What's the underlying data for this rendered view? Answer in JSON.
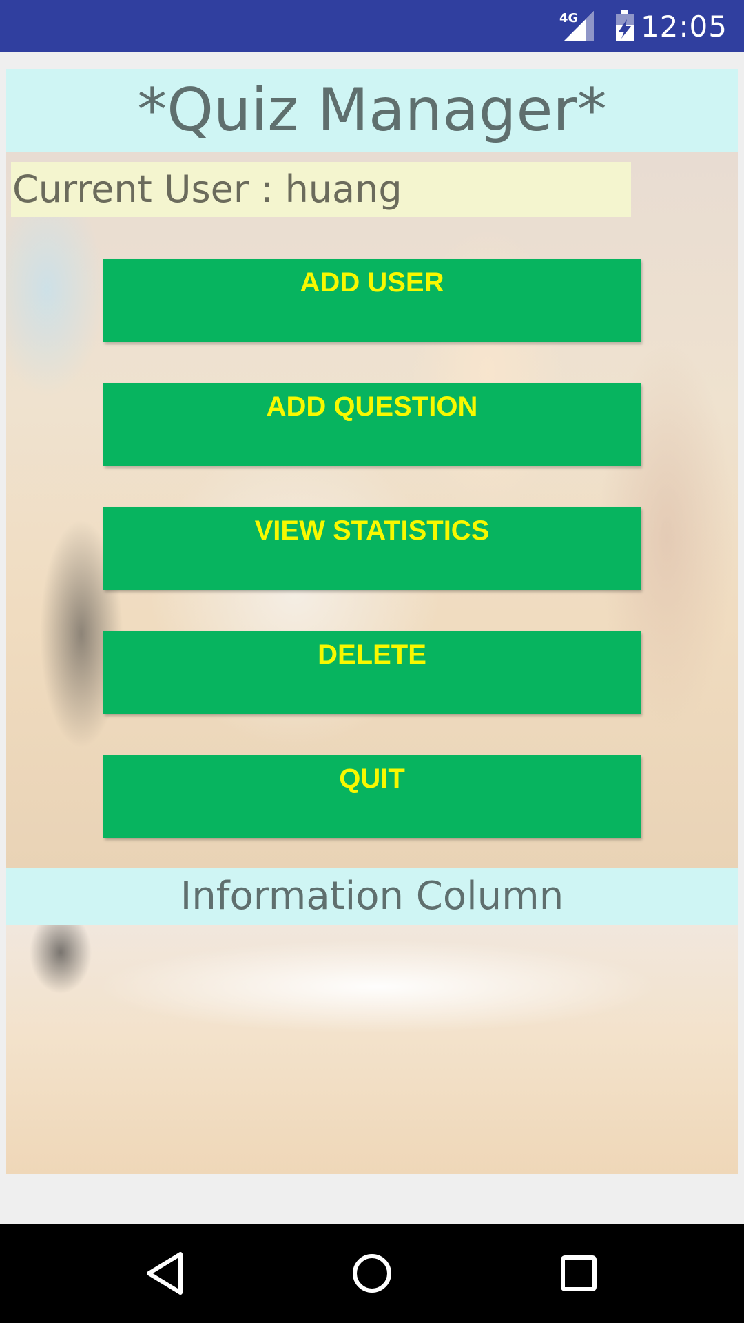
{
  "status_bar": {
    "time": "12:05",
    "network_label": "4G",
    "icons": [
      "signal-icon",
      "battery-icon"
    ]
  },
  "app": {
    "title": "*Quiz Manager*",
    "current_user": "Current User : huang",
    "buttons": [
      {
        "label": "ADD USER"
      },
      {
        "label": "ADD QUESTION"
      },
      {
        "label": "VIEW STATISTICS"
      },
      {
        "label": "DELETE"
      },
      {
        "label": "QUIT"
      }
    ],
    "info_title": "Information Column"
  },
  "navigation": {
    "icons": [
      "back-icon",
      "home-icon",
      "recents-icon"
    ]
  },
  "colors": {
    "status_bar": "#303f9f",
    "title_bg": "#cff5f4",
    "user_label_bg": "#f4f5cf",
    "button_bg": "#07b45f",
    "button_text": "#f8f800"
  }
}
